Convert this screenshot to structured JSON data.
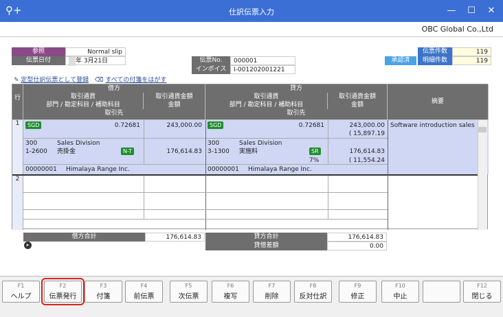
{
  "window": {
    "title": "仕訳伝票入力"
  },
  "company": "OBC Global Co.,Ltd",
  "header": {
    "ref_label": "参照",
    "ref_value": "Normal slip",
    "date_label": "伝票日付",
    "date_value": "年 3月21日",
    "slip_no_label": "伝票No.",
    "slip_no_value": "000001",
    "invoice_no_label": "インボイスNo.",
    "invoice_no_value": "I-001202001221",
    "approved_badge": "承認済",
    "slip_count_label": "伝票件数",
    "slip_count_value": "119",
    "detail_count_label": "明細件数",
    "detail_count_value": "119"
  },
  "links": {
    "register_template": "定型仕訳伝票として登録",
    "remove_all_notes": "すべての付箋をはがす"
  },
  "grid": {
    "row_label": "行",
    "debit_header": "借方",
    "credit_header": "貸方",
    "currency_header": "取引通貨",
    "currency_amount_header": "取引通貨金額",
    "dept_header": "部門 / 勘定科目 / 補助科目",
    "amount_header": "金額",
    "partner_header": "取引先",
    "memo_header": "摘要",
    "rows": [
      {
        "num": "1",
        "debit": {
          "currency": "SGD",
          "rate": "0.72681",
          "currency_amount": "243,000.00",
          "dept_code": "300",
          "dept_name": "Sales Division",
          "account_code": "1-2600",
          "account_name": "売掛金",
          "tax_tag": "N-T",
          "amount": "176,614.83",
          "partner_code": "00000001",
          "partner_name": "Himalaya Range Inc."
        },
        "credit": {
          "currency": "SGD",
          "rate": "0.72681",
          "currency_amount": "243,000.00",
          "currency_tax": "( 15,897.19",
          "dept_code": "300",
          "dept_name": "Sales Division",
          "account_code": "3-1300",
          "account_name": "実施料",
          "tax_tag": "SR",
          "tax_rate": "7%",
          "amount": "176,614.83",
          "tax_amount": "( 11,554.24",
          "partner_code": "00000001",
          "partner_name": "Himalaya Range Inc."
        },
        "memo": "Software introduction sales"
      },
      {
        "num": "2"
      }
    ]
  },
  "totals": {
    "debit_total_label": "借方合計",
    "debit_total": "176,614.83",
    "credit_total_label": "貸方合計",
    "credit_total": "176,614.83",
    "diff_label": "貸借差額",
    "diff": "0.00"
  },
  "fkeys": [
    {
      "key": "F1",
      "name": "ヘルプ"
    },
    {
      "key": "F2",
      "name": "伝票発行"
    },
    {
      "key": "F3",
      "name": "付箋"
    },
    {
      "key": "F4",
      "name": "前伝票"
    },
    {
      "key": "F5",
      "name": "次伝票"
    },
    {
      "key": "F6",
      "name": "複写"
    },
    {
      "key": "F7",
      "name": "削除"
    },
    {
      "key": "F8",
      "name": "反対仕訳"
    },
    {
      "key": "F9",
      "name": "修正"
    },
    {
      "key": "F10",
      "name": "中止"
    },
    {
      "key": "",
      "name": ""
    },
    {
      "key": "F12",
      "name": "閉じる"
    }
  ]
}
